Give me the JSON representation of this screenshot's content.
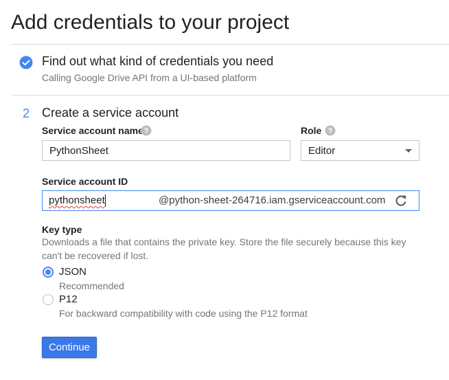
{
  "page": {
    "title": "Add credentials to your project"
  },
  "step1": {
    "title": "Find out what kind of credentials you need",
    "subtitle": "Calling Google Drive API from a UI-based platform",
    "status_icon": "check-circle-icon"
  },
  "step2": {
    "number": "2",
    "title": "Create a service account",
    "service_account_name": {
      "label": "Service account name",
      "value": "PythonSheet"
    },
    "role": {
      "label": "Role",
      "selected": "Editor"
    },
    "service_account_id": {
      "label": "Service account ID",
      "value": "pythonsheet",
      "suffix": "@python-sheet-264716.iam.gserviceaccount.com"
    },
    "key_type": {
      "label": "Key type",
      "description": "Downloads a file that contains the private key. Store the file securely because this key can't be recovered if lost.",
      "options": [
        {
          "label": "JSON",
          "sublabel": "Recommended",
          "checked": true
        },
        {
          "label": "P12",
          "sublabel": "For backward compatibility with code using the P12 format",
          "checked": false
        }
      ]
    },
    "continue_label": "Continue"
  },
  "colors": {
    "accent": "#4285f4",
    "button": "#3b78e7"
  }
}
